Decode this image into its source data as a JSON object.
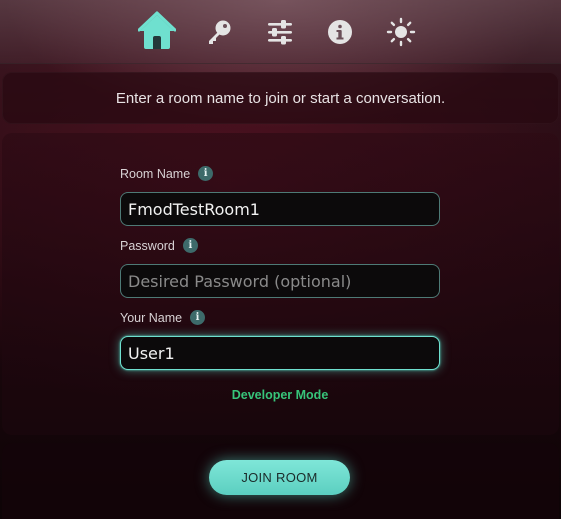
{
  "nav": {
    "items": [
      {
        "icon": "home-icon",
        "active": true
      },
      {
        "icon": "key-icon",
        "active": false
      },
      {
        "icon": "sliders-icon",
        "active": false
      },
      {
        "icon": "info-icon",
        "active": false
      },
      {
        "icon": "sun-icon",
        "active": false
      }
    ]
  },
  "banner": {
    "text": "Enter a room name to join or start a conversation."
  },
  "form": {
    "room_name": {
      "label": "Room Name",
      "value": "FmodTestRoom1",
      "placeholder": ""
    },
    "password": {
      "label": "Password",
      "value": "",
      "placeholder": "Desired Password (optional)"
    },
    "your_name": {
      "label": "Your Name",
      "value": "User1",
      "placeholder": ""
    },
    "developer_mode_label": "Developer Mode"
  },
  "actions": {
    "join_label": "JOIN ROOM"
  },
  "colors": {
    "accent": "#6fe0cf",
    "developer_mode": "#37c47a",
    "info_badge": "#3d6a6a"
  }
}
